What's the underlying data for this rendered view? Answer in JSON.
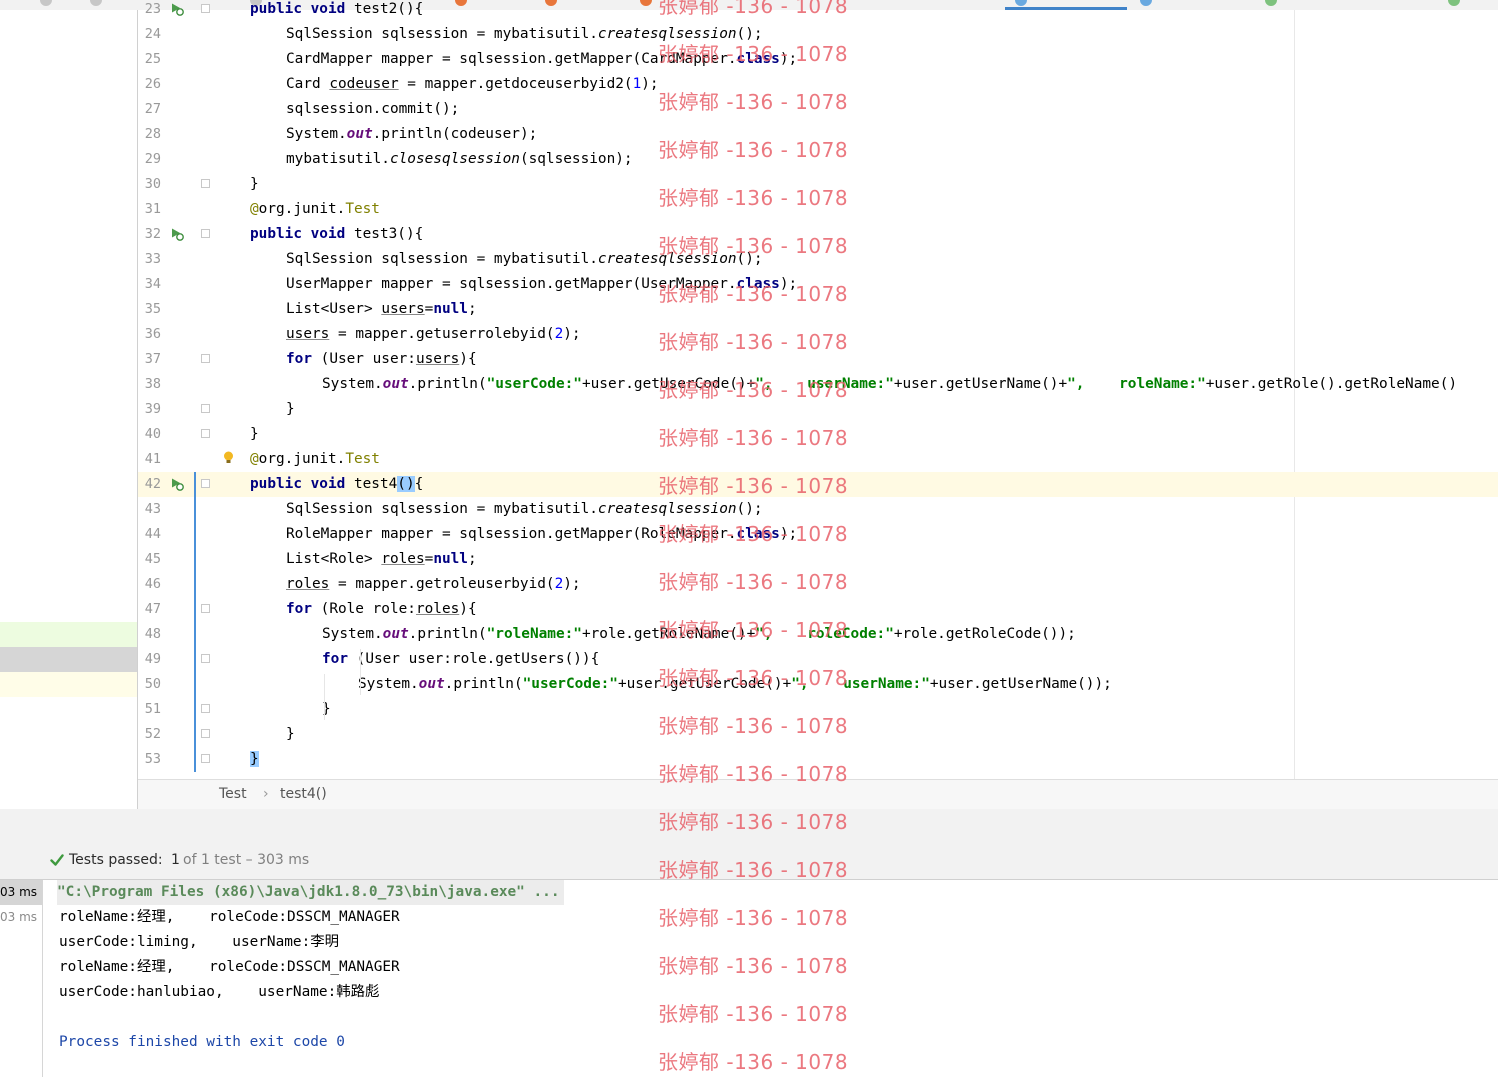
{
  "tabs": [
    {
      "color": "#c7c7c7"
    },
    {
      "color": "#c7c7c7"
    },
    {
      "color": "#c7c7c7"
    },
    {
      "color": "#e8763b"
    },
    {
      "color": "#e8763b"
    },
    {
      "color": "#e8763b"
    },
    {
      "color": "#6aa9e0",
      "active": true
    },
    {
      "color": "#6aa9e0"
    },
    {
      "color": "#7ec27e"
    },
    {
      "color": "#7ec27e"
    }
  ],
  "editor": {
    "lines": [
      {
        "n": "23",
        "tokens": [
          [
            "kw",
            "public void "
          ],
          [
            "",
            "test2(){"
          ]
        ],
        "indent": 1,
        "fold": true,
        "run": true
      },
      {
        "n": "24",
        "tokens": [
          [
            "",
            "SqlSession sqlsession = mybatisutil."
          ],
          [
            "ital",
            "createsqlsession"
          ],
          [
            "",
            "();"
          ]
        ],
        "indent": 2
      },
      {
        "n": "25",
        "tokens": [
          [
            "",
            "CardMapper mapper = sqlsession.getMapper(CardMapper."
          ],
          [
            "kw",
            "class"
          ],
          [
            "",
            ");"
          ]
        ],
        "indent": 2
      },
      {
        "n": "26",
        "tokens": [
          [
            "",
            "Card "
          ],
          [
            "ul",
            "codeuser"
          ],
          [
            "",
            " = mapper.getdoceuserbyid2("
          ],
          [
            "num",
            "1"
          ],
          [
            "",
            ");"
          ]
        ],
        "indent": 2
      },
      {
        "n": "27",
        "tokens": [
          [
            "",
            "sqlsession.commit();"
          ]
        ],
        "indent": 2
      },
      {
        "n": "28",
        "tokens": [
          [
            "",
            "System."
          ],
          [
            "field",
            "out"
          ],
          [
            "",
            ".println(codeuser);"
          ]
        ],
        "indent": 2
      },
      {
        "n": "29",
        "tokens": [
          [
            "",
            "mybatisutil."
          ],
          [
            "ital",
            "closesqlsession"
          ],
          [
            "",
            "(sqlsession);"
          ]
        ],
        "indent": 2
      },
      {
        "n": "30",
        "tokens": [
          [
            "",
            "}"
          ]
        ],
        "indent": 1,
        "fold": true
      },
      {
        "n": "31",
        "tokens": [
          [
            "ann",
            "@"
          ],
          [
            "",
            "org.junit."
          ],
          [
            "ann",
            "Test"
          ]
        ],
        "indent": 1
      },
      {
        "n": "32",
        "tokens": [
          [
            "kw",
            "public void "
          ],
          [
            "",
            "test3(){"
          ]
        ],
        "indent": 1,
        "fold": true,
        "run": true
      },
      {
        "n": "33",
        "tokens": [
          [
            "",
            "SqlSession sqlsession = mybatisutil."
          ],
          [
            "ital",
            "createsqlsession"
          ],
          [
            "",
            "();"
          ]
        ],
        "indent": 2
      },
      {
        "n": "34",
        "tokens": [
          [
            "",
            "UserMapper mapper = sqlsession.getMapper(UserMapper."
          ],
          [
            "kw",
            "class"
          ],
          [
            "",
            ");"
          ]
        ],
        "indent": 2
      },
      {
        "n": "35",
        "tokens": [
          [
            "",
            "List<User> "
          ],
          [
            "ul",
            "users"
          ],
          [
            "",
            "="
          ],
          [
            "kw",
            "null"
          ],
          [
            "",
            ";"
          ]
        ],
        "indent": 2
      },
      {
        "n": "36",
        "tokens": [
          [
            "ul",
            "users"
          ],
          [
            "",
            " = mapper.getuserrolebyid("
          ],
          [
            "num",
            "2"
          ],
          [
            "",
            ");"
          ]
        ],
        "indent": 2
      },
      {
        "n": "37",
        "tokens": [
          [
            "kw",
            "for "
          ],
          [
            "",
            "(User user:"
          ],
          [
            "ul",
            "users"
          ],
          [
            "",
            "){"
          ]
        ],
        "indent": 2,
        "fold": true
      },
      {
        "n": "38",
        "tokens": [
          [
            "",
            "System."
          ],
          [
            "field",
            "out"
          ],
          [
            "",
            ".println("
          ],
          [
            "str",
            "\"userCode:\""
          ],
          [
            "",
            "+user.getUserCode()+"
          ],
          [
            "str",
            "\",    userName:\""
          ],
          [
            "",
            "+user.getUserName()+"
          ],
          [
            "str",
            "\",    roleName:\""
          ],
          [
            "",
            "+user.getRole().getRoleName()"
          ]
        ],
        "indent": 3
      },
      {
        "n": "39",
        "tokens": [
          [
            "",
            "}"
          ]
        ],
        "indent": 2,
        "fold": true
      },
      {
        "n": "40",
        "tokens": [
          [
            "",
            "}"
          ]
        ],
        "indent": 1,
        "fold": true
      },
      {
        "n": "41",
        "tokens": [
          [
            "ann",
            "@"
          ],
          [
            "",
            "org.junit."
          ],
          [
            "ann",
            "Test"
          ]
        ],
        "indent": 1,
        "bulb": true
      },
      {
        "n": "42",
        "tokens": [
          [
            "kw",
            "public void "
          ],
          [
            "",
            "test4"
          ],
          [
            "hl",
            "("
          ],
          [
            "",
            ""
          ],
          [
            "hl",
            ")"
          ],
          [
            "",
            "{"
          ]
        ],
        "indent": 1,
        "fold": true,
        "run": true,
        "current": true
      },
      {
        "n": "43",
        "tokens": [
          [
            "",
            "SqlSession sqlsession = mybatisutil."
          ],
          [
            "ital",
            "createsqlsession"
          ],
          [
            "",
            "();"
          ]
        ],
        "indent": 2
      },
      {
        "n": "44",
        "tokens": [
          [
            "",
            "RoleMapper mapper = sqlsession.getMapper(RoleMapper."
          ],
          [
            "kw",
            "class"
          ],
          [
            "",
            ");"
          ]
        ],
        "indent": 2
      },
      {
        "n": "45",
        "tokens": [
          [
            "",
            "List<Role> "
          ],
          [
            "ul",
            "roles"
          ],
          [
            "",
            "="
          ],
          [
            "kw",
            "null"
          ],
          [
            "",
            ";"
          ]
        ],
        "indent": 2
      },
      {
        "n": "46",
        "tokens": [
          [
            "ul",
            "roles"
          ],
          [
            "",
            " = mapper.getroleuserbyid("
          ],
          [
            "num",
            "2"
          ],
          [
            "",
            ");"
          ]
        ],
        "indent": 2
      },
      {
        "n": "47",
        "tokens": [
          [
            "kw",
            "for "
          ],
          [
            "",
            "(Role role:"
          ],
          [
            "ul",
            "roles"
          ],
          [
            "",
            "){"
          ]
        ],
        "indent": 2,
        "fold": true
      },
      {
        "n": "48",
        "tokens": [
          [
            "",
            "System."
          ],
          [
            "field",
            "out"
          ],
          [
            "",
            ".println("
          ],
          [
            "str",
            "\"roleName:\""
          ],
          [
            "",
            "+role.getRoleName()+"
          ],
          [
            "str",
            "\",    roleCode:\""
          ],
          [
            "",
            "+role.getRoleCode());"
          ]
        ],
        "indent": 3
      },
      {
        "n": "49",
        "tokens": [
          [
            "kw",
            "for "
          ],
          [
            "",
            "(User user:role.getUsers()){"
          ]
        ],
        "indent": 3,
        "fold": true
      },
      {
        "n": "50",
        "tokens": [
          [
            "",
            "System."
          ],
          [
            "field",
            "out"
          ],
          [
            "",
            ".println("
          ],
          [
            "str",
            "\"userCode:\""
          ],
          [
            "",
            "+user.getUserCode()+"
          ],
          [
            "str",
            "\",    userName:\""
          ],
          [
            "",
            "+user.getUserName());"
          ]
        ],
        "indent": 4
      },
      {
        "n": "51",
        "tokens": [
          [
            "",
            "}"
          ]
        ],
        "indent": 3,
        "fold": true
      },
      {
        "n": "52",
        "tokens": [
          [
            "",
            "}"
          ]
        ],
        "indent": 2,
        "fold": true
      },
      {
        "n": "53",
        "tokens": [
          [
            "hl",
            "}"
          ]
        ],
        "indent": 1,
        "fold": true
      }
    ]
  },
  "breadcrumb": {
    "class_name": "Test",
    "separator": "›",
    "method_name": "test4()"
  },
  "test_status": {
    "label": "Tests passed:",
    "passed": "1",
    "rest": "of 1 test – 303 ms"
  },
  "durations": [
    {
      "text": "03 ms",
      "selected": true
    },
    {
      "text": "03 ms",
      "selected": false
    }
  ],
  "console": {
    "lines": [
      {
        "text": "\"C:\\Program Files (x86)\\Java\\jdk1.8.0_73\\bin\\java.exe\" ...",
        "kind": "cmd"
      },
      {
        "text": "roleName:经理,    roleCode:DSSCM_MANAGER",
        "kind": "out"
      },
      {
        "text": "userCode:liming,    userName:李明",
        "kind": "out"
      },
      {
        "text": "roleName:经理,    roleCode:DSSCM_MANAGER",
        "kind": "out"
      },
      {
        "text": "userCode:hanlubiao,    userName:韩路彪",
        "kind": "out"
      },
      {
        "text": "",
        "kind": "out"
      },
      {
        "text": "Process finished with exit code 0",
        "kind": "exit"
      }
    ]
  },
  "watermark": {
    "text": "张婷郁 -136 - 1078"
  }
}
